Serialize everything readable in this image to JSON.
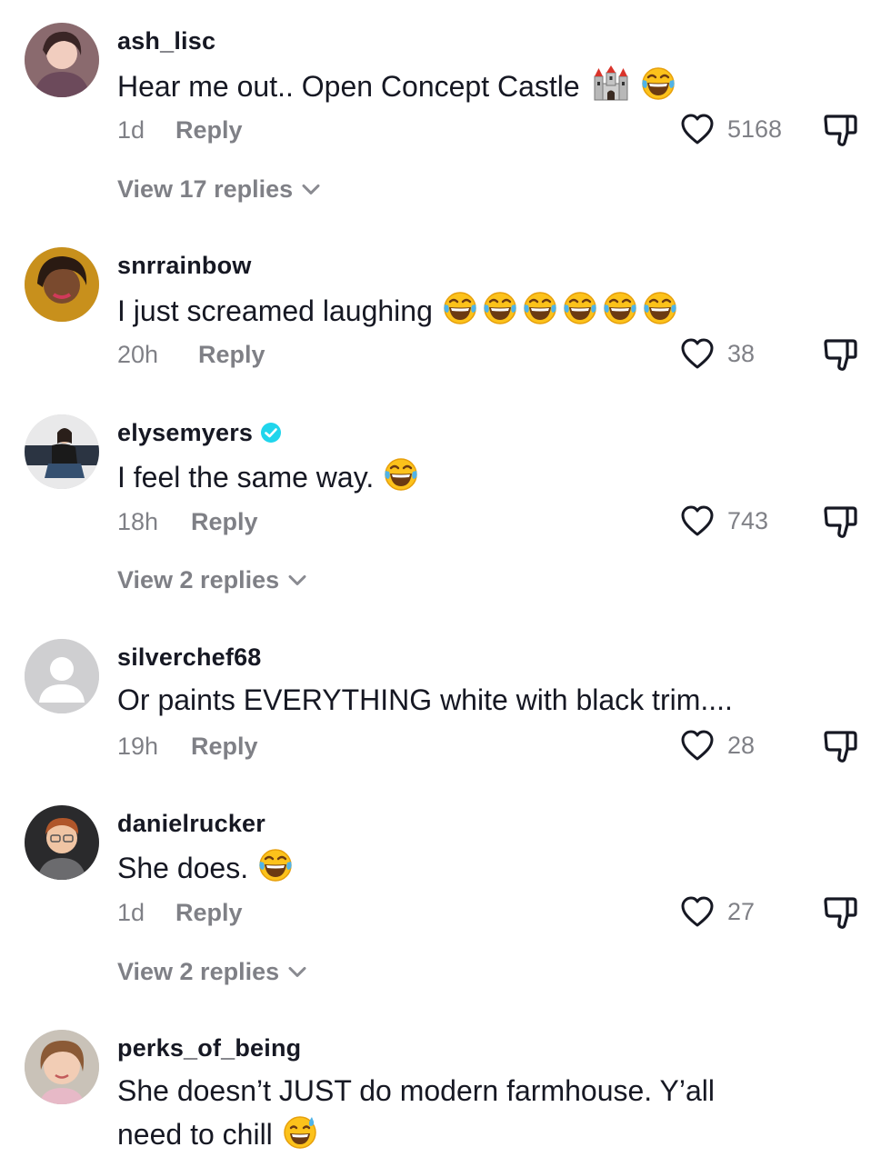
{
  "comments": [
    {
      "username": "ash_lisc",
      "text": "Hear me out.. Open Concept Castle",
      "emojis": [
        "castle-emoji",
        "tears-of-joy-emoji"
      ],
      "time": "1d",
      "reply_label": "Reply",
      "likes": "5168",
      "view_replies": "View 17 replies"
    },
    {
      "username": "snrrainbow",
      "text": "I just screamed laughing",
      "emojis": [
        "tears-of-joy-emoji",
        "tears-of-joy-emoji",
        "tears-of-joy-emoji",
        "tears-of-joy-emoji",
        "tears-of-joy-emoji",
        "tears-of-joy-emoji"
      ],
      "time": "20h",
      "reply_label": "Reply",
      "likes": "38"
    },
    {
      "username": "elysemyers",
      "verified": true,
      "text": "I feel the same way.",
      "emojis": [
        "tears-of-joy-emoji"
      ],
      "time": "18h",
      "reply_label": "Reply",
      "likes": "743",
      "view_replies": "View 2 replies"
    },
    {
      "username": "silverchef68",
      "text": "Or paints EVERYTHING white with black trim....",
      "time": "19h",
      "reply_label": "Reply",
      "likes": "28"
    },
    {
      "username": "danielrucker",
      "text": "She does.",
      "emojis": [
        "tears-of-joy-emoji"
      ],
      "time": "1d",
      "reply_label": "Reply",
      "likes": "27",
      "view_replies": "View 2 replies"
    },
    {
      "username": "perks_of_being",
      "text_line1": "She doesn’t JUST do modern farmhouse. Y’all",
      "text_line2": "need to chill",
      "emojis": [
        "grinning-sweat-emoji"
      ]
    }
  ],
  "icons": {
    "like": "heart-outline-icon",
    "dislike": "thumbs-down-icon",
    "expand": "chevron-down-icon",
    "verified": "verified-badge-icon"
  },
  "colors": {
    "text": "#161823",
    "secondary": "#8a8b91",
    "verified": "#20d5ec"
  }
}
